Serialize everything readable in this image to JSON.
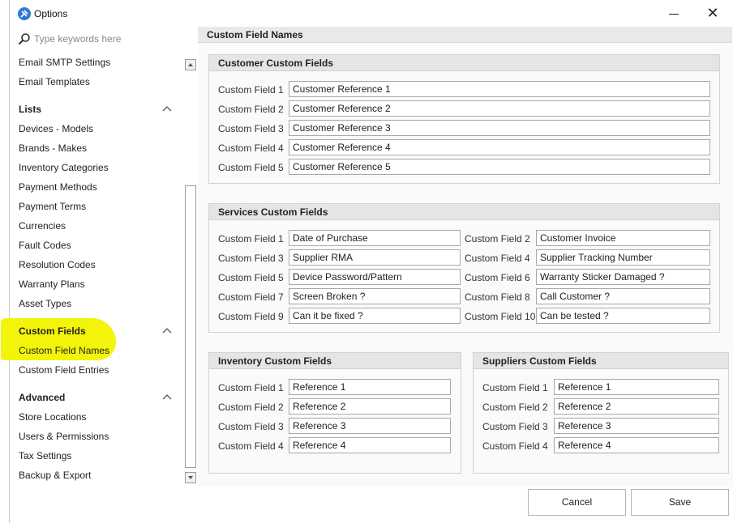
{
  "window": {
    "title": "Options"
  },
  "search": {
    "placeholder": "Type keywords here"
  },
  "sidebar": {
    "top_items": [
      "Email SMTP Settings",
      "Email Templates"
    ],
    "lists": {
      "header": "Lists",
      "items": [
        "Devices - Models",
        "Brands - Makes",
        "Inventory Categories",
        "Payment Methods",
        "Payment Terms",
        "Currencies",
        "Fault Codes",
        "Resolution Codes",
        "Warranty Plans",
        "Asset Types"
      ]
    },
    "custom_fields": {
      "header": "Custom Fields",
      "items": [
        "Custom Field Names",
        "Custom Field Entries"
      ]
    },
    "advanced": {
      "header": "Advanced",
      "items": [
        "Store Locations",
        "Users & Permissions",
        "Tax Settings",
        "Backup & Export"
      ]
    }
  },
  "main": {
    "title": "Custom Field Names",
    "customer": {
      "title": "Customer Custom Fields",
      "fields": [
        {
          "label": "Custom Field 1",
          "value": "Customer Reference 1"
        },
        {
          "label": "Custom Field 2",
          "value": "Customer Reference 2"
        },
        {
          "label": "Custom Field 3",
          "value": "Customer Reference 3"
        },
        {
          "label": "Custom Field 4",
          "value": "Customer Reference 4"
        },
        {
          "label": "Custom Field 5",
          "value": "Customer Reference 5"
        }
      ]
    },
    "services": {
      "title": "Services Custom Fields",
      "fields": [
        {
          "label": "Custom Field 1",
          "value": "Date of Purchase"
        },
        {
          "label": "Custom Field 2",
          "value": "Customer Invoice"
        },
        {
          "label": "Custom Field 3",
          "value": "Supplier RMA"
        },
        {
          "label": "Custom Field 4",
          "value": "Supplier Tracking Number"
        },
        {
          "label": "Custom Field 5",
          "value": "Device Password/Pattern"
        },
        {
          "label": "Custom Field 6",
          "value": "Warranty Sticker Damaged ?"
        },
        {
          "label": "Custom Field 7",
          "value": "Screen Broken ?"
        },
        {
          "label": "Custom Field 8",
          "value": "Call Customer ?"
        },
        {
          "label": "Custom Field 9",
          "value": "Can it be fixed ?"
        },
        {
          "label": "Custom Field 10",
          "value": "Can be tested ?"
        }
      ]
    },
    "inventory": {
      "title": "Inventory Custom Fields",
      "fields": [
        {
          "label": "Custom Field 1",
          "value": "Reference 1"
        },
        {
          "label": "Custom Field 2",
          "value": "Reference 2"
        },
        {
          "label": "Custom Field 3",
          "value": "Reference 3"
        },
        {
          "label": "Custom Field 4",
          "value": "Reference 4"
        }
      ]
    },
    "suppliers": {
      "title": "Suppliers Custom Fields",
      "fields": [
        {
          "label": "Custom Field 1",
          "value": "Reference 1"
        },
        {
          "label": "Custom Field 2",
          "value": "Reference 2"
        },
        {
          "label": "Custom Field 3",
          "value": "Reference 3"
        },
        {
          "label": "Custom Field 4",
          "value": "Reference 4"
        }
      ]
    }
  },
  "footer": {
    "cancel_label": "Cancel",
    "save_label": "Save"
  },
  "colors": {
    "highlight": "#f4f40a",
    "group_header": "#e5e5e5",
    "app_icon": "#2e7ad1"
  },
  "icons": {
    "app": "tools-icon",
    "search": "search-icon",
    "collapse": "chevron-up-icon",
    "close": "close-icon",
    "minimize": "minimize-icon"
  }
}
